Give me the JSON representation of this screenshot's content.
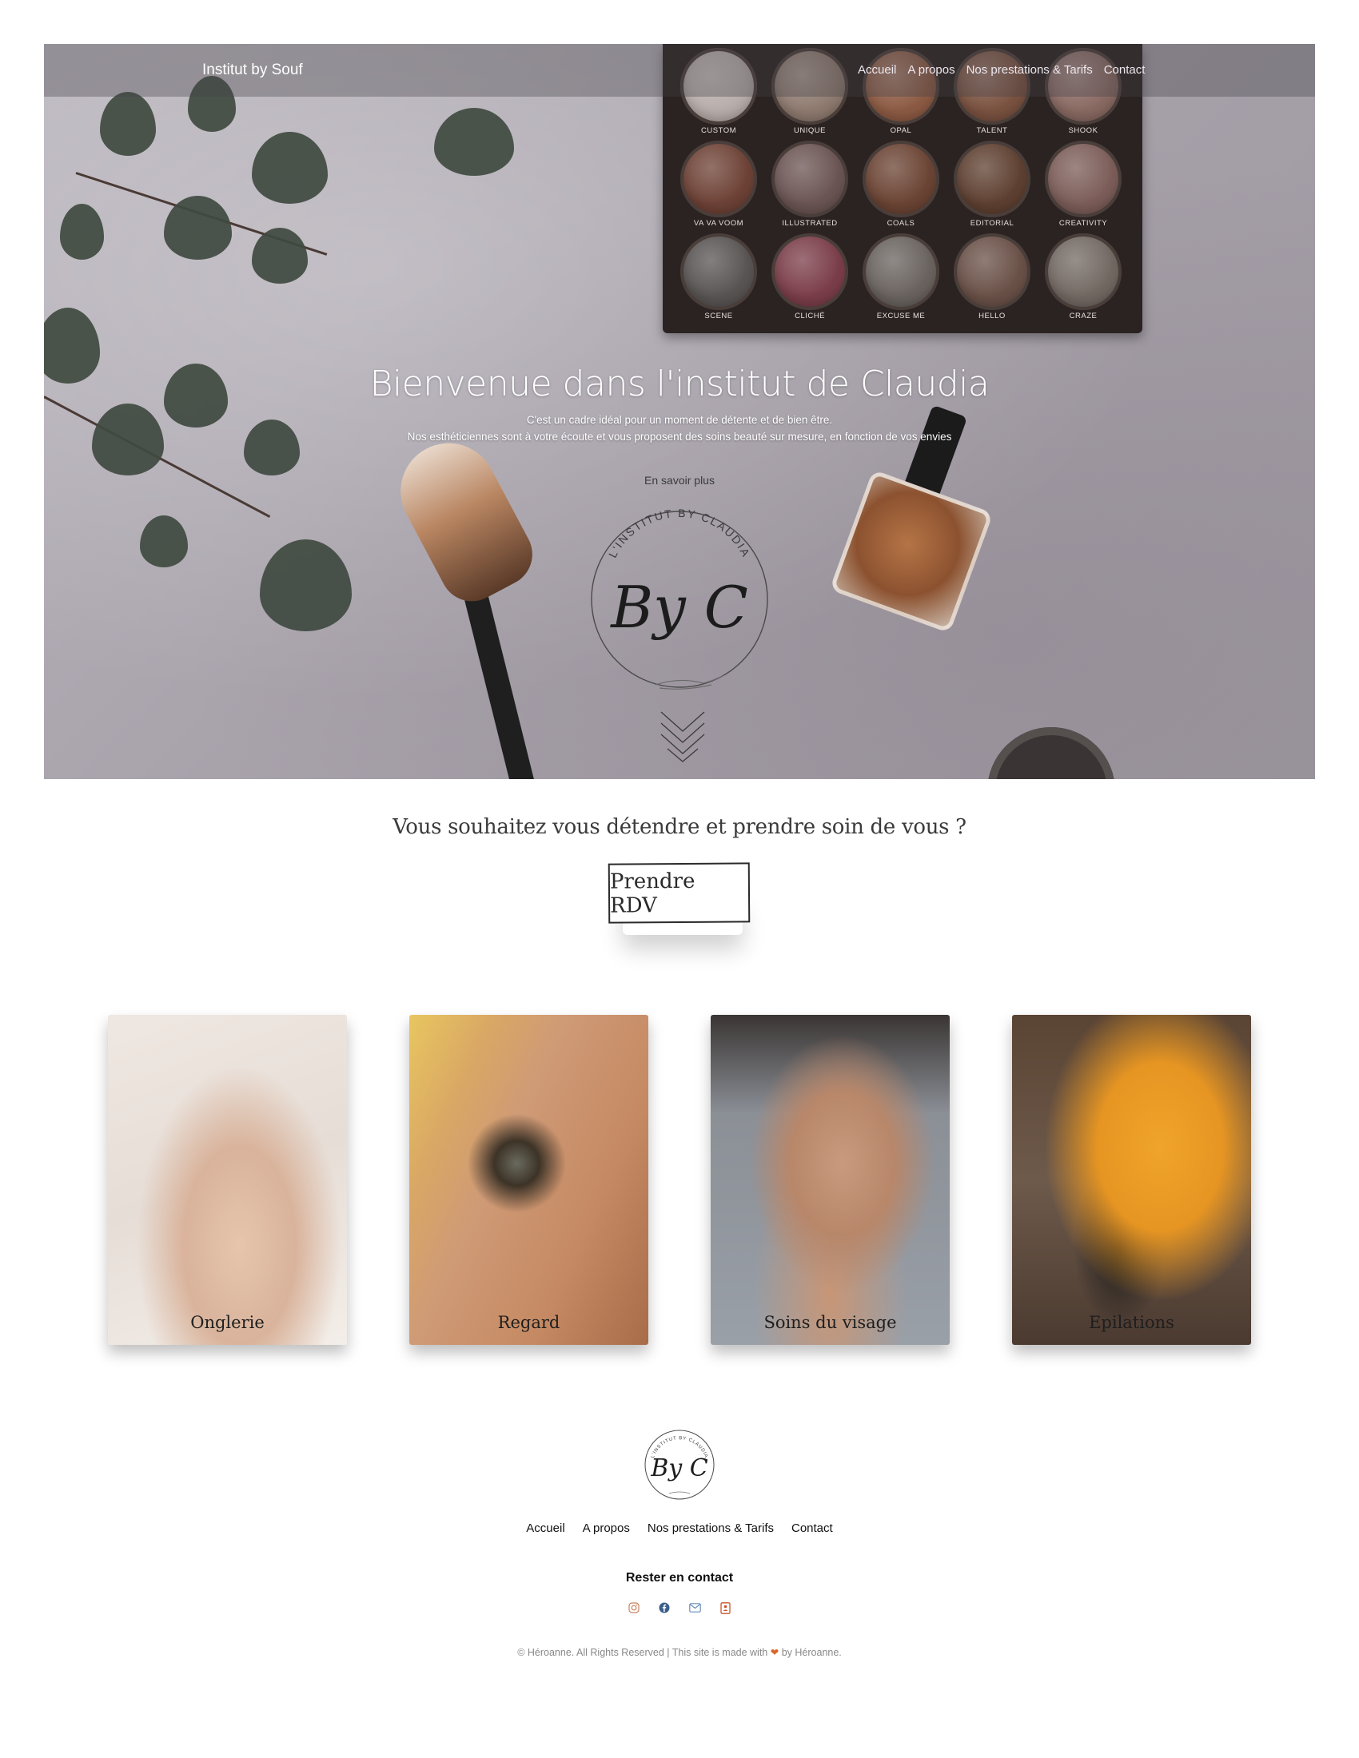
{
  "header": {
    "brand": "Institut by Souf",
    "nav": [
      "Accueil",
      "A propos",
      "Nos prestations & Tarifs",
      "Contact"
    ]
  },
  "palette": {
    "shades": [
      "CUSTOM",
      "UNIQUE",
      "OPAL",
      "TALENT",
      "SHOOK",
      "VA VA VOOM",
      "ILLUSTRATED",
      "COALS",
      "EDITORIAL",
      "CREATIVITY",
      "SCENE",
      "CLICHÉ",
      "EXCUSE ME",
      "HELLO",
      "CRAZE"
    ],
    "colors": [
      "#b8aeab",
      "#8f7b70",
      "#8d5b44",
      "#7b5240",
      "#8a6a63",
      "#6e4236",
      "#6b5554",
      "#6b4434",
      "#5e4031",
      "#7c5d59",
      "#595554",
      "#7b3e4a",
      "#6a635f",
      "#6a5148",
      "#736963"
    ]
  },
  "hero": {
    "title": "Bienvenue dans l'institut de Claudia",
    "subtitle_line1": "C'est un cadre idéal pour un moment de détente et de bien être.",
    "subtitle_line2": "Nos esthéticiennes sont à votre écoute et vous proposent des soins beauté sur mesure, en fonction de vos envies",
    "more_link": "En savoir plus",
    "logo_ring_text": "L'INSTITUT BY CLAUDIA",
    "logo_monogram": "By C"
  },
  "cta": {
    "question": "Vous souhaitez vous détendre et prendre soin de vous ?",
    "button": "Prendre RDV"
  },
  "services": [
    {
      "label": "Onglerie",
      "icon": "nails-photo"
    },
    {
      "label": "Regard",
      "icon": "eye-photo"
    },
    {
      "label": "Soins du visage",
      "icon": "face-care-photo"
    },
    {
      "label": "Epilations",
      "icon": "waxing-photo"
    }
  ],
  "footer": {
    "nav": [
      "Accueil",
      "A propos",
      "Nos prestations & Tarifs",
      "Contact"
    ],
    "stay_in_touch": "Rester en contact",
    "socials": [
      {
        "icon": "instagram-icon",
        "color": "#c9825f"
      },
      {
        "icon": "facebook-icon",
        "color": "#3b5f8a"
      },
      {
        "icon": "email-icon",
        "color": "#6b8fb8"
      },
      {
        "icon": "contact-book-icon",
        "color": "#c9572b"
      }
    ],
    "copyright_pre": "© Héroanne. All Rights Reserved | This site is made with",
    "copyright_post": "by Héroanne."
  }
}
